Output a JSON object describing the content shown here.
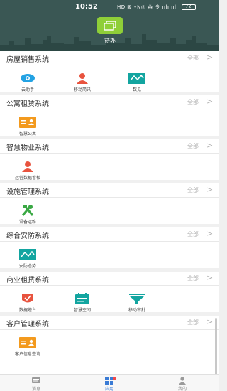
{
  "status_bar": {
    "time": "10:52",
    "icons": "HD ⊠ •N◎ ⁂ 令 ıılı ıılı",
    "battery": "72"
  },
  "header": {
    "pending_label": "待办"
  },
  "colors": {
    "header_bg": "#3a5754",
    "pending_green": "#8fcf38",
    "orange": "#f39a1e",
    "red": "#e8533e",
    "teal": "#13a5a0",
    "blue": "#23a2e3",
    "tab_active": "#3a7bd5"
  },
  "sections": [
    {
      "title": "房屋销售系统",
      "all_label": "全部",
      "arrow": ">",
      "items": [
        {
          "label": "云助手",
          "icon": "eye-icon"
        },
        {
          "label": "移动简讯",
          "icon": "person-icon"
        },
        {
          "label": "数见",
          "icon": "chart-icon"
        }
      ]
    },
    {
      "title": "公寓租赁系统",
      "all_label": "全部",
      "arrow": ">",
      "items": [
        {
          "label": "智慧公寓",
          "icon": "id-card-icon"
        }
      ]
    },
    {
      "title": "智慧物业系统",
      "all_label": "全部",
      "arrow": ">",
      "items": [
        {
          "label": "运营数据看板",
          "icon": "person-icon"
        }
      ]
    },
    {
      "title": "设施管理系统",
      "all_label": "全部",
      "arrow": ">",
      "items": [
        {
          "label": "设备运维",
          "icon": "tools-icon"
        }
      ]
    },
    {
      "title": "综合安防系统",
      "all_label": "全部",
      "arrow": ">",
      "items": [
        {
          "label": "安防态势",
          "icon": "chart-icon"
        }
      ]
    },
    {
      "title": "商业租赁系统",
      "all_label": "全部",
      "arrow": ">",
      "items": [
        {
          "label": "数据塔台",
          "icon": "shield-check-icon"
        },
        {
          "label": "智慧空间",
          "icon": "calendar-icon"
        },
        {
          "label": "移动审批",
          "icon": "filter-icon"
        }
      ]
    },
    {
      "title": "客户管理系统",
      "all_label": "全部",
      "arrow": ">",
      "items": [
        {
          "label": "客户信息查询",
          "icon": "id-card-icon"
        }
      ]
    }
  ],
  "tabbar": [
    {
      "label": "消息",
      "icon": "message-icon"
    },
    {
      "label": "应用",
      "icon": "apps-icon"
    },
    {
      "label": "我的",
      "icon": "user-icon"
    }
  ]
}
